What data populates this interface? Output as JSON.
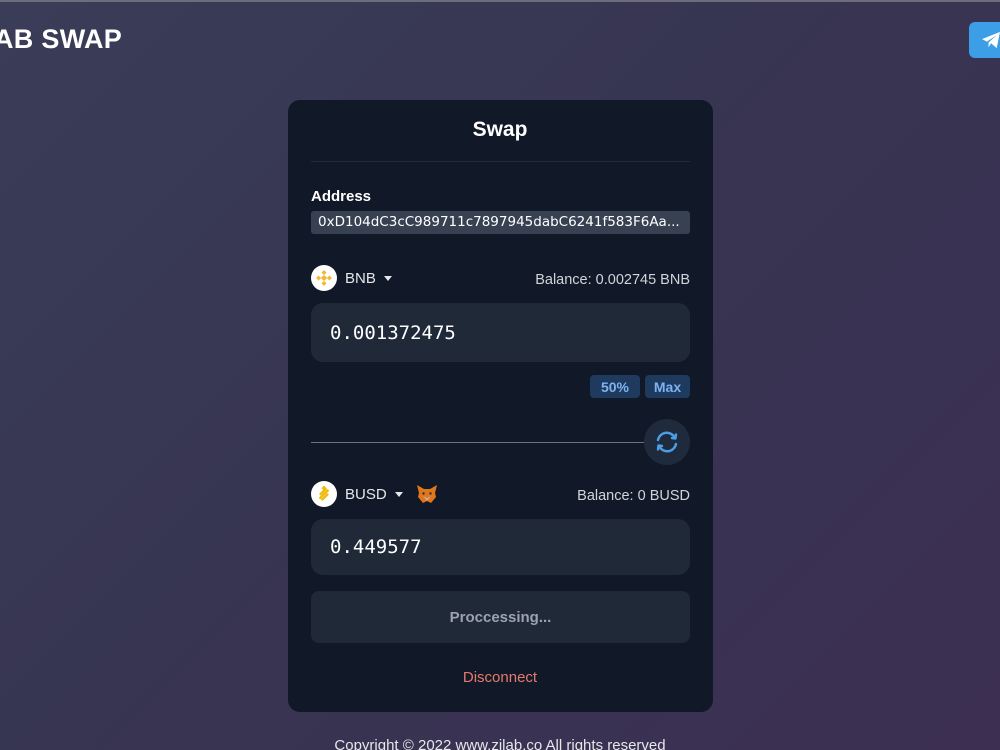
{
  "brand": "AB SWAP",
  "swap": {
    "title": "Swap",
    "address_label": "Address",
    "address_value": "0xD104dC3cC989711c7897945dabC6241f583F6Aa...",
    "from": {
      "token": "BNB",
      "balance": "Balance: 0.002745 BNB",
      "amount": "0.001372475",
      "icon": "bnb-icon"
    },
    "percent_buttons": {
      "half": "50%",
      "max": "Max"
    },
    "to": {
      "token": "BUSD",
      "balance": "Balance: 0 BUSD",
      "amount": "0.449577",
      "icon": "busd-icon"
    },
    "submit_label": "Proccessing...",
    "disconnect_label": "Disconnect"
  },
  "footer": "Copyright © 2022 www.zilab.co All rights reserved",
  "colors": {
    "card": "#111827",
    "input": "#1f2937",
    "accent_blue": "#3b9ee6",
    "bnb_yellow": "#f3ba2f",
    "disconnect_red": "#e47a6e"
  },
  "icons": [
    "telegram-icon",
    "bnb-icon",
    "busd-icon",
    "swap-refresh-icon",
    "metamask-fox-icon",
    "chevron-down-icon"
  ]
}
